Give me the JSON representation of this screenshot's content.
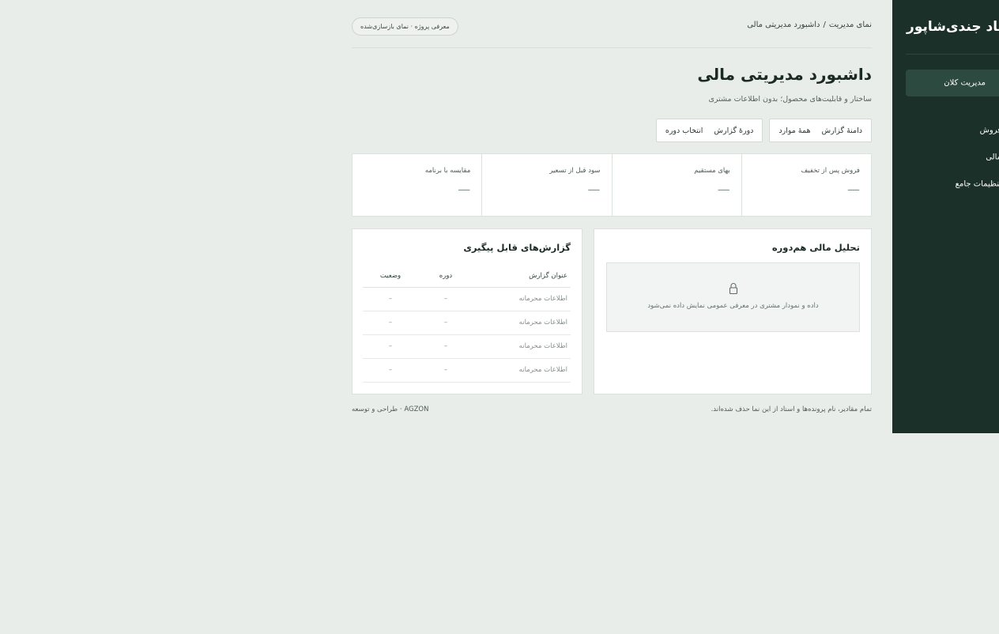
{
  "sidebar": {
    "brand": "جندی‌شاپور",
    "brand_prefix": "یاد ",
    "items": [
      {
        "label": "مدیریت کلان"
      },
      {
        "label": "فروش"
      },
      {
        "label": "مالی"
      },
      {
        "label": "تنظیمات جامع"
      }
    ]
  },
  "header": {
    "breadcrumb_root": "نمای مدیریت",
    "breadcrumb_sep": "/",
    "breadcrumb_current": "داشبورد مدیریتی مالی",
    "intro_pill": "معرفی پروژه · نمای بازسازی‌شده"
  },
  "page": {
    "title": "داشبورد مدیریتی مالی",
    "subtitle": "ساختار و قابلیت‌های محصول؛ بدون اطلاعات مشتری"
  },
  "filters": [
    {
      "label": "دامنهٔ گزارش",
      "value": "همهٔ موارد"
    },
    {
      "label": "دورهٔ گزارش",
      "value": "انتخاب دوره"
    }
  ],
  "kpis": [
    {
      "label": "فروش پس از تخفیف",
      "value": "—"
    },
    {
      "label": "بهای مستقیم",
      "value": "—"
    },
    {
      "label": "سود قبل از تسعیر",
      "value": "—"
    },
    {
      "label": "مقایسه با برنامه",
      "value": "—"
    }
  ],
  "analysis": {
    "title": "تحلیل مالی هم‌دوره",
    "locked_text": "داده و نمودار مشتری در معرفی عمومی نمایش داده نمی‌شود",
    "icon": "lock-icon"
  },
  "reports": {
    "title": "گزارش‌های قابل پیگیری",
    "columns": {
      "title": "عنوان گزارش",
      "period": "دوره",
      "status": "وضعیت"
    },
    "rows": [
      {
        "title": "اطلاعات محرمانه",
        "period": "–",
        "status": "–"
      },
      {
        "title": "اطلاعات محرمانه",
        "period": "–",
        "status": "–"
      },
      {
        "title": "اطلاعات محرمانه",
        "period": "–",
        "status": "–"
      },
      {
        "title": "اطلاعات محرمانه",
        "period": "–",
        "status": "–"
      }
    ]
  },
  "footer": {
    "note": "تمام مقادیر، نام پرونده‌ها و اسناد از این نما حذف شده‌اند.",
    "credit": "AGZON · طراحی و توسعه"
  },
  "colors": {
    "sidebar_bg": "#1b3029",
    "sidebar_active": "#2d4a40",
    "page_bg": "#e9ede9",
    "card_bg": "#ffffff"
  }
}
